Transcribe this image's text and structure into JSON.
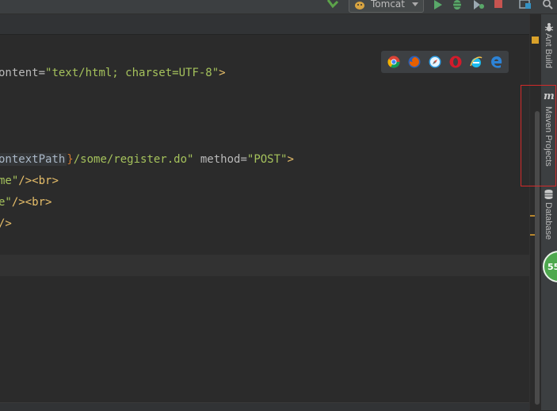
{
  "toolbar": {
    "run_config": "Tomcat"
  },
  "editor": {
    "lines": [
      {
        "attr_frag": "ontent=",
        "value": "\"text/html; charset=UTF-8\"",
        "end": ">"
      },
      {
        "ctx": "ontextPath",
        "brace": "}",
        "path": "/some/register.do\"",
        "method_attr": " method=",
        "method_val": "\"POST\"",
        "end": ">"
      },
      {
        "frag": "me\"",
        "tag": "/><br>"
      },
      {
        "frag": "e\"",
        "tag": "/><br>"
      },
      {
        "frag": "",
        "tag": "/>"
      }
    ]
  },
  "right_panel": {
    "tabs": [
      {
        "label": "Ant Build"
      },
      {
        "label": "Maven Projects"
      },
      {
        "label": "Database"
      }
    ],
    "badge": "55"
  },
  "colors": {
    "accent_red": "#d22a2a",
    "badge_green": "#4ea84e"
  },
  "icons": [
    "hammer-icon",
    "run-icon",
    "debug-icon",
    "coverage-icon",
    "stop-icon",
    "project-structure-icon",
    "search-icon"
  ]
}
